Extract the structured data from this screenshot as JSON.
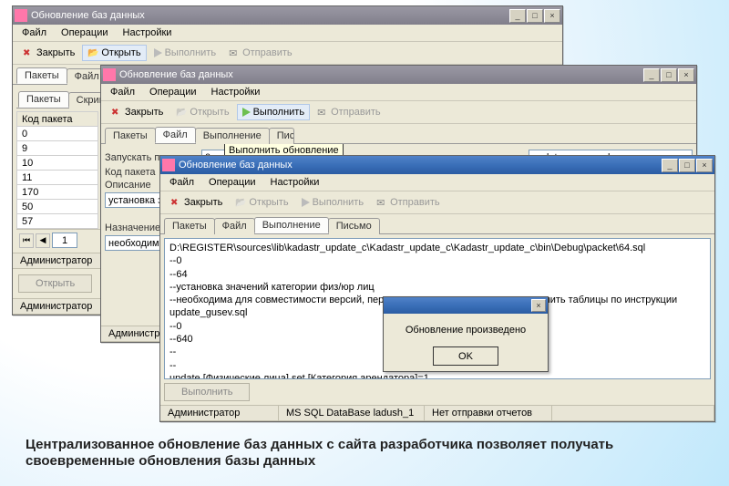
{
  "title": "Обновление баз данных",
  "menus": {
    "file": "Файл",
    "ops": "Операции",
    "settings": "Настройки"
  },
  "toolbar": {
    "close": "Закрыть",
    "open": "Открыть",
    "run": "Выполнить",
    "send": "Отправить"
  },
  "tabs": {
    "packets": "Пакеты",
    "file": "Файл",
    "exec": "Выполнение",
    "letter": "Письмо",
    "b": "В",
    "scripts": "Скрипты"
  },
  "w1": {
    "grid_header": "Код пакета",
    "rows": [
      "0",
      "9",
      "10",
      "11",
      "170",
      "50",
      "57"
    ],
    "page": "1",
    "status": "Администратор",
    "open_btn": "Открыть"
  },
  "w2": {
    "launch_after_lbl": "Запускать после",
    "launch_after_val": "0",
    "launch_after_file": "update_gusev.sql",
    "code_lbl": "Код пакета",
    "desc_lbl": "Описание",
    "desc_val": "установка зна",
    "purpose_lbl": "Назначение",
    "purpose_val": "необходима д",
    "tooltip": "Выполнить обновление",
    "status": "Администратор"
  },
  "w3": {
    "log": "D:\\REGISTER\\sources\\lib\\kadastr_update_c\\Kadastr_update_c\\Kadastr_update_c\\bin\\Debug\\packet\\64.sql\n--0\n--64\n--установка значений категории физ/юр лиц\n--необходима для совместимости версий, перед выполнением - создать и заполнить таблицы по инструкции\nupdate_gusev.sql\n--0\n--640\n--\n--\nupdate [Физические лица] set [Категория арендатора]=1\nupdate [Юридические лица] set [Категория арендатора]=1\n\nGO\nОбновление проведено успешно!",
    "run_btn": "Выполнить",
    "status1": "Администратор",
    "status2": "MS SQL DataBase ladush_1",
    "status3": "Нет отправки отчетов"
  },
  "dialog": {
    "msg": "Обновление произведено",
    "ok": "OK"
  },
  "caption": "Централизованное обновление баз данных с сайта разработчика позволяет получать своевременные обновления базы данных"
}
